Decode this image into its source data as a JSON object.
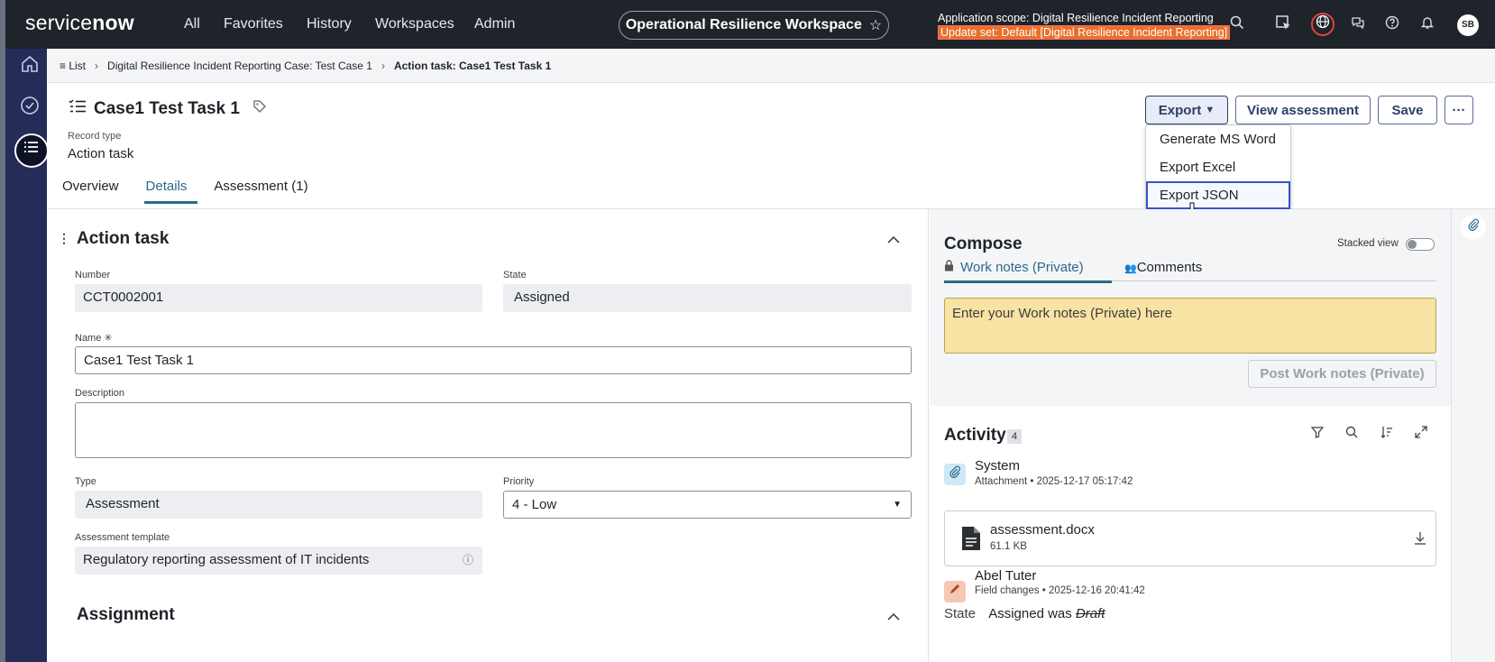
{
  "topbar": {
    "logo": "servicenow",
    "nav": [
      "All",
      "Favorites",
      "History",
      "Workspaces",
      "Admin"
    ],
    "workspace": "Operational Resilience Workspace",
    "scope_line": "Application scope: Digital Resilience Incident Reporting",
    "update_set_line": "Update set: Default [Digital Resilience Incident Reporting]",
    "avatar_initials": "SB"
  },
  "breadcrumb": {
    "list": "List",
    "parent": "Digital Resilience Incident Reporting Case: Test Case 1",
    "current": "Action task: Case1 Test Task 1"
  },
  "record": {
    "title": "Case1 Test Task 1",
    "record_type_label": "Record type",
    "record_type_value": "Action task"
  },
  "tabs": [
    "Overview",
    "Details",
    "Assessment (1)"
  ],
  "actions": {
    "export": "Export",
    "view_assessment": "View assessment",
    "save": "Save",
    "more": "···"
  },
  "export_menu": [
    "Generate MS Word",
    "Export Excel",
    "Export JSON"
  ],
  "form": {
    "section": "Action task",
    "number_label": "Number",
    "number_value": "CCT0002001",
    "state_label": "State",
    "state_value": "Assigned",
    "name_label": "Name",
    "name_value": "Case1 Test Task 1",
    "description_label": "Description",
    "description_value": "",
    "type_label": "Type",
    "type_value": "Assessment",
    "priority_label": "Priority",
    "priority_value": "4 - Low",
    "template_label": "Assessment template",
    "template_value": "Regulatory reporting assessment of IT incidents",
    "assignment_section": "Assignment"
  },
  "compose": {
    "title": "Compose",
    "stacked_view": "Stacked view",
    "tab_worknotes": "Work notes (Private)",
    "tab_comments": "Comments",
    "placeholder": "Enter your Work notes (Private) here",
    "post_button": "Post Work notes (Private)"
  },
  "activity": {
    "title": "Activity",
    "count": "4",
    "entries": [
      {
        "who": "System",
        "type": "Attachment",
        "time": "2025-12-17 05:17:42",
        "file": "assessment.docx",
        "size": "61.1 KB"
      },
      {
        "who": "Abel Tuter",
        "type": "Field changes",
        "time": "2025-12-16 20:41:42",
        "field": "State",
        "new": "Assigned",
        "was": "was",
        "old": "Draft"
      }
    ]
  }
}
